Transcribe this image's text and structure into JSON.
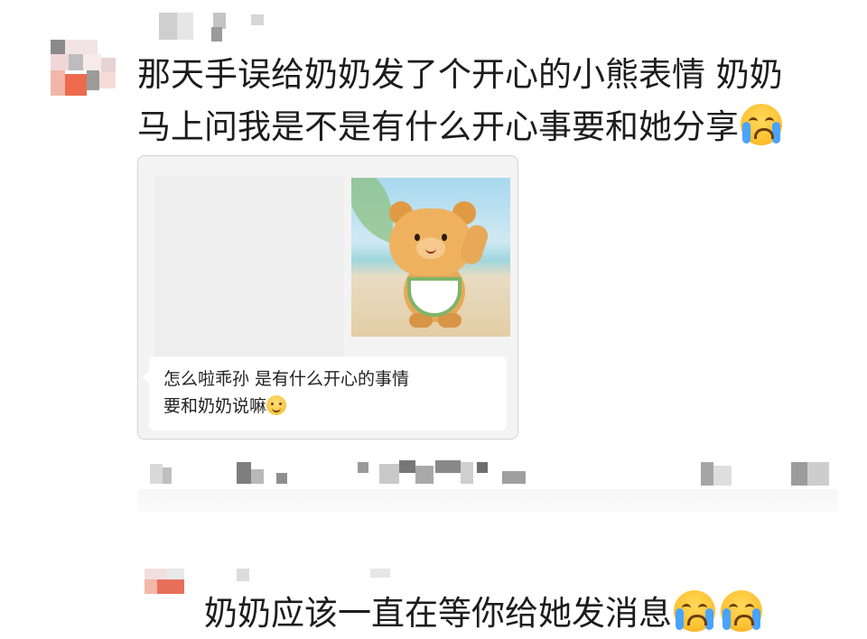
{
  "post": {
    "line1": "那天手误给奶奶发了个开心的小熊表情 奶奶",
    "line2": "马上问我是不是有什么开心事要和她分享",
    "emoji": "crying-emoji"
  },
  "screenshot": {
    "reply_line1": "怎么啦乖孙 是有什么开心的事情",
    "reply_line2": "要和奶奶说嘛",
    "reply_emoji": "smile-emoji",
    "sticker_image": "bear-sticker"
  },
  "comment": {
    "text": "奶奶应该一直在等你给她发消息",
    "emoji": "crying-emoji"
  }
}
